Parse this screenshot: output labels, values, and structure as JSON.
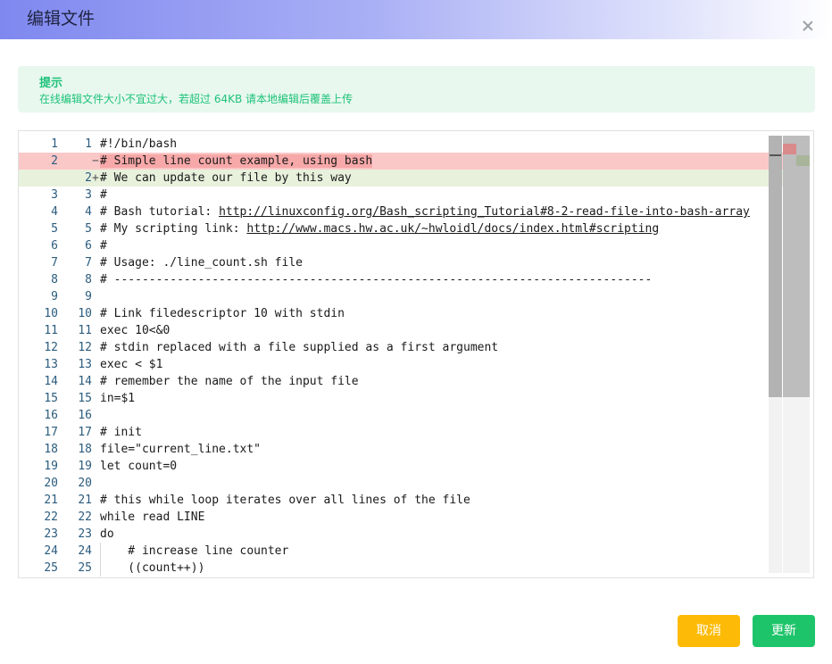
{
  "dialog": {
    "title": "编辑文件"
  },
  "tip": {
    "title": "提示",
    "text": "在线编辑文件大小不宜过大，若超过 64KB 请本地编辑后覆盖上传"
  },
  "buttons": {
    "cancel": "取消",
    "update": "更新"
  },
  "colors": {
    "cancel": "#fdbb08",
    "update": "#1ec46a",
    "tip_bg": "#e8f8ee",
    "tip_text": "#1fc27a",
    "deleted_line": "#fbc8c8",
    "added_line": "#e8f1dc"
  },
  "editor": {
    "lines": [
      {
        "ln1": "1",
        "ln2": "1",
        "mark": "",
        "code": "#!/bin/bash",
        "type": ""
      },
      {
        "ln1": "2",
        "ln2": "",
        "mark": "−",
        "code": "# Simple line count example, using bash",
        "type": "del"
      },
      {
        "ln1": "",
        "ln2": "2",
        "mark": "+",
        "code": "# We can update our file by this way",
        "type": "add"
      },
      {
        "ln1": "3",
        "ln2": "3",
        "mark": "",
        "code": "#",
        "type": ""
      },
      {
        "ln1": "4",
        "ln2": "4",
        "mark": "",
        "code": "# Bash tutorial: ",
        "link": "http://linuxconfig.org/Bash_scripting_Tutorial#8-2-read-file-into-bash-array",
        "type": ""
      },
      {
        "ln1": "5",
        "ln2": "5",
        "mark": "",
        "code": "# My scripting link: ",
        "link": "http://www.macs.hw.ac.uk/~hwloidl/docs/index.html#scripting",
        "type": ""
      },
      {
        "ln1": "6",
        "ln2": "6",
        "mark": "",
        "code": "#",
        "type": ""
      },
      {
        "ln1": "7",
        "ln2": "7",
        "mark": "",
        "code": "# Usage: ./line_count.sh file",
        "type": ""
      },
      {
        "ln1": "8",
        "ln2": "8",
        "mark": "",
        "code": "# -----------------------------------------------------------------------------",
        "type": ""
      },
      {
        "ln1": "9",
        "ln2": "9",
        "mark": "",
        "code": "",
        "type": ""
      },
      {
        "ln1": "10",
        "ln2": "10",
        "mark": "",
        "code": "# Link filedescriptor 10 with stdin",
        "type": ""
      },
      {
        "ln1": "11",
        "ln2": "11",
        "mark": "",
        "code": "exec 10<&0",
        "type": ""
      },
      {
        "ln1": "12",
        "ln2": "12",
        "mark": "",
        "code": "# stdin replaced with a file supplied as a first argument",
        "type": ""
      },
      {
        "ln1": "13",
        "ln2": "13",
        "mark": "",
        "code": "exec < $1",
        "type": ""
      },
      {
        "ln1": "14",
        "ln2": "14",
        "mark": "",
        "code": "# remember the name of the input file",
        "type": ""
      },
      {
        "ln1": "15",
        "ln2": "15",
        "mark": "",
        "code": "in=$1",
        "type": ""
      },
      {
        "ln1": "16",
        "ln2": "16",
        "mark": "",
        "code": "",
        "type": ""
      },
      {
        "ln1": "17",
        "ln2": "17",
        "mark": "",
        "code": "# init",
        "type": ""
      },
      {
        "ln1": "18",
        "ln2": "18",
        "mark": "",
        "code": "file=\"current_line.txt\"",
        "type": ""
      },
      {
        "ln1": "19",
        "ln2": "19",
        "mark": "",
        "code": "let count=0",
        "type": ""
      },
      {
        "ln1": "20",
        "ln2": "20",
        "mark": "",
        "code": "",
        "type": ""
      },
      {
        "ln1": "21",
        "ln2": "21",
        "mark": "",
        "code": "# this while loop iterates over all lines of the file",
        "type": ""
      },
      {
        "ln1": "22",
        "ln2": "22",
        "mark": "",
        "code": "while read LINE",
        "type": ""
      },
      {
        "ln1": "23",
        "ln2": "23",
        "mark": "",
        "code": "do",
        "type": ""
      },
      {
        "ln1": "24",
        "ln2": "24",
        "mark": "",
        "code": "    # increase line counter",
        "type": "indent"
      },
      {
        "ln1": "25",
        "ln2": "25",
        "mark": "",
        "code": "    ((count++))",
        "type": "indent"
      }
    ]
  }
}
